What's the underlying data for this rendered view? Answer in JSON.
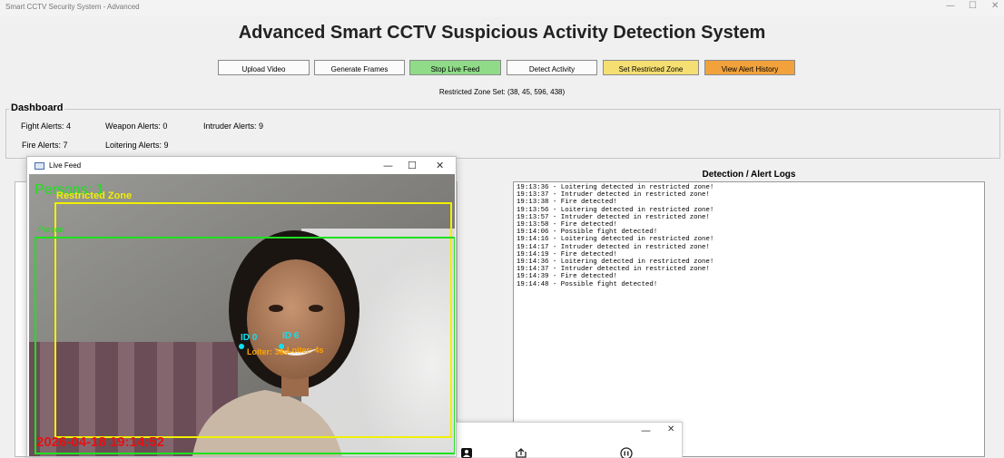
{
  "window": {
    "title": "Smart CCTV Security System - Advanced",
    "controls": [
      "—",
      "☐",
      "✕"
    ]
  },
  "app": {
    "heading": "Advanced Smart CCTV Suspicious Activity Detection System"
  },
  "toolbar": {
    "upload": "Upload Video",
    "generate": "Generate Frames",
    "stop": "Stop Live Feed",
    "detect": "Detect Activity",
    "zone": "Set Restricted Zone",
    "history": "View Alert History",
    "colors": {
      "stop": "#8fdb88",
      "zone": "#f5df73",
      "history": "#f2a23c"
    }
  },
  "zone_status": "Restricted Zone Set: (38, 45, 596, 438)",
  "dashboard": {
    "title": "Dashboard",
    "fight": "Fight Alerts: 4",
    "weapon": "Weapon Alerts: 0",
    "intruder": "Intruder Alerts: 9",
    "fire": "Fire Alerts: 7",
    "loiter": "Loitering Alerts: 9"
  },
  "logs": {
    "title": "Detection / Alert Logs",
    "text": "19:13:36 - Loitering detected in restricted zone!\n19:13:37 - Intruder detected in restricted zone!\n19:13:38 - Fire detected!\n19:13:56 - Loitering detected in restricted zone!\n19:13:57 - Intruder detected in restricted zone!\n19:13:58 - Fire detected!\n19:14:06 - Possible fight detected!\n19:14:16 - Loitering detected in restricted zone!\n19:14:17 - Intruder detected in restricted zone!\n19:14:19 - Fire detected!\n19:14:36 - Loitering detected in restricted zone!\n19:14:37 - Intruder detected in restricted zone!\n19:14:39 - Fire detected!\n19:14:48 - Possible fight detected!"
  },
  "live_feed": {
    "title": "Live Feed",
    "controls": [
      "—",
      "☐",
      "✕"
    ],
    "overlay": {
      "persons": "Persons: 1",
      "zone_label": "Restricted Zone",
      "person_label": "Person",
      "id0": "ID 0",
      "id6": "ID 6",
      "loiter0": "Loiter: 38s",
      "loiter6": "Loiter: 4s",
      "timestamp": "2026-04-18 19:14:52",
      "colors": {
        "green": "#1fe01f",
        "yellow": "#f0f000",
        "cyan": "#10e0f0",
        "orange": "#ffa500",
        "red": "#e81010"
      }
    }
  },
  "mini_player": {
    "controls": [
      "—",
      "✕"
    ],
    "icons": [
      "person-icon",
      "share-icon",
      "pause-icon"
    ]
  }
}
